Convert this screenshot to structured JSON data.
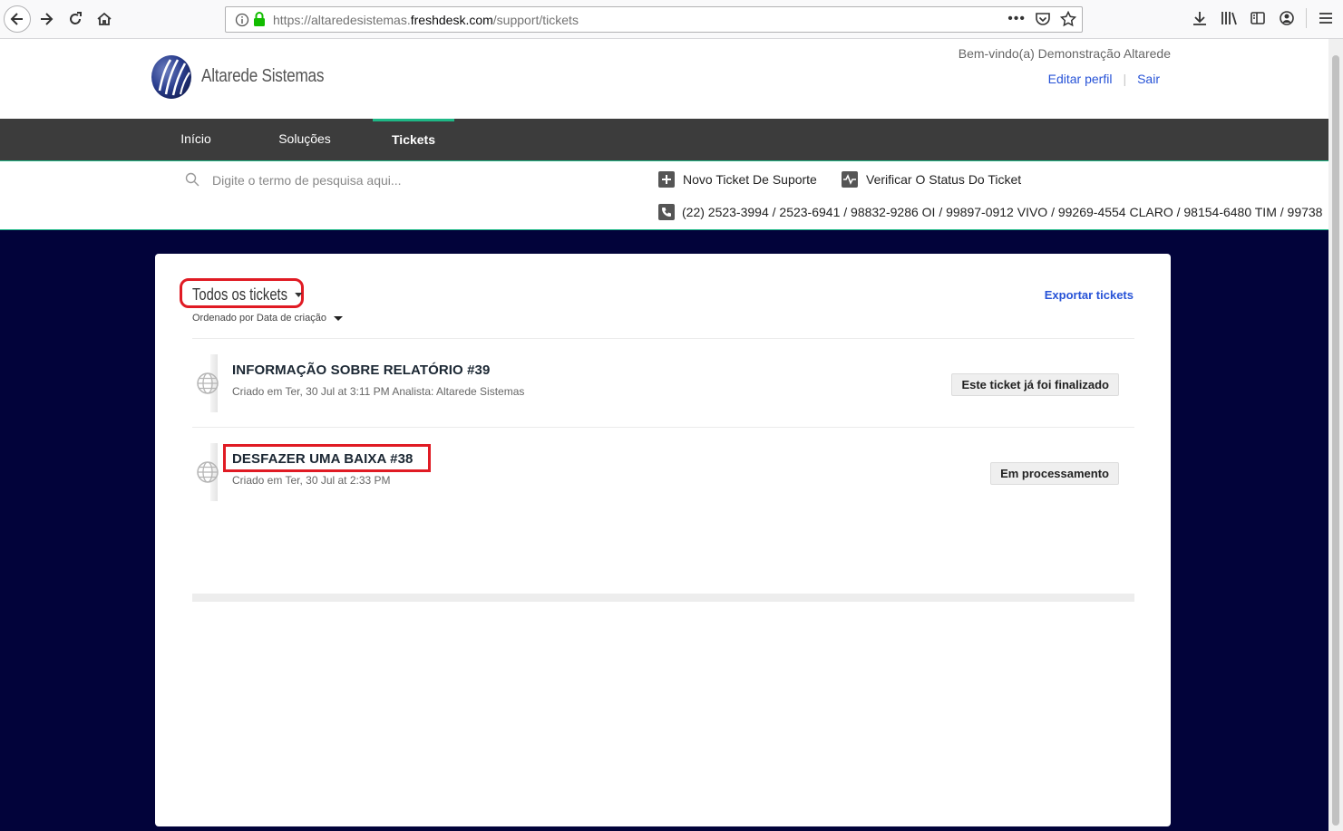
{
  "browser": {
    "url_prefix": "https://altaredesistemas.",
    "url_domain": "freshdesk.com",
    "url_path": "/support/tickets"
  },
  "header": {
    "brand": "Altarede Sistemas",
    "welcome": "Bem-vindo(a) Demonstração Altarede",
    "edit_profile": "Editar perfil",
    "logout": "Sair"
  },
  "nav": {
    "home": "Início",
    "solutions": "Soluções",
    "tickets": "Tickets"
  },
  "search": {
    "placeholder": "Digite o termo de pesquisa aqui..."
  },
  "actions": {
    "new_ticket": "Novo Ticket De Suporte",
    "check_status": "Verificar O Status Do Ticket",
    "phones": "(22) 2523-3994 / 2523-6941 / 98832-9286 OI / 99897-0912 VIVO / 99269-4554 CLARO / 98154-6480 TIM / 99738"
  },
  "tickets_panel": {
    "filter": "Todos os tickets",
    "sort": "Ordenado por Data de criação",
    "export": "Exportar tickets",
    "items": [
      {
        "title": "INFORMAÇÃO SOBRE RELATÓRIO #39",
        "meta": "Criado em Ter, 30 Jul at 3:11 PM Analista: Altarede Sistemas",
        "status": "Este ticket já foi finalizado"
      },
      {
        "title": "DESFAZER UMA BAIXA #38",
        "meta": "Criado em Ter, 30 Jul at 2:33 PM",
        "status": "Em processamento"
      }
    ]
  },
  "colors": {
    "page_bg": "#02033a",
    "nav_bg": "#3c3c3c",
    "accent_green": "#1eb886",
    "link_blue": "#2753d7",
    "highlight_red": "#e01b24"
  }
}
